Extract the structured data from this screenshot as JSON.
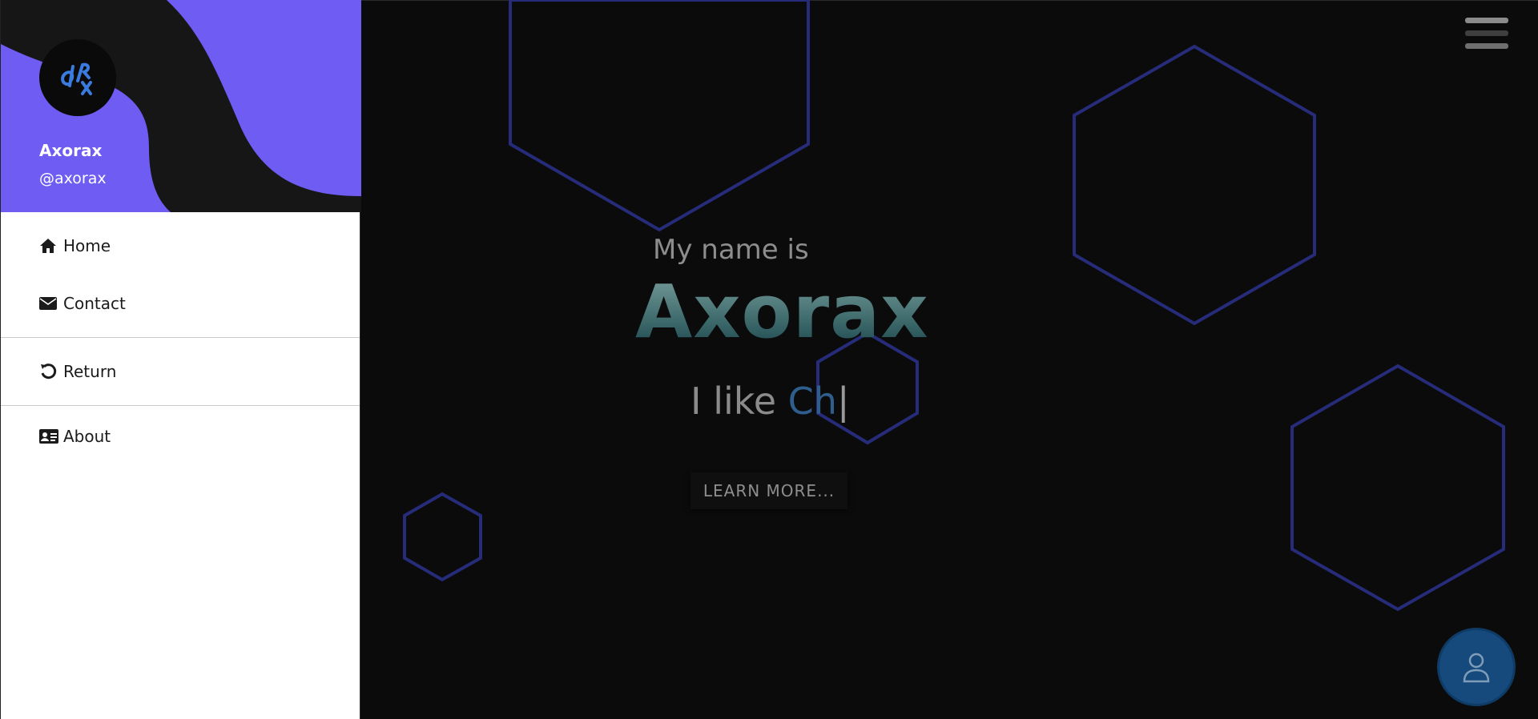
{
  "profile": {
    "name": "Axorax",
    "handle": "@axorax",
    "avatar_icon": "drx-logo-icon"
  },
  "sidebar": {
    "items": [
      {
        "label": "Home",
        "icon": "home-icon"
      },
      {
        "label": "Contact",
        "icon": "envelope-icon"
      },
      {
        "label": "Return",
        "icon": "undo-icon"
      },
      {
        "label": "About",
        "icon": "id-card-icon"
      }
    ]
  },
  "hero": {
    "intro": "My name is",
    "name": "Axorax",
    "typed_prefix": "I like ",
    "typed_word": "Ch",
    "cursor": "|",
    "button_label": "LEARN MORE..."
  },
  "colors": {
    "accent_purple": "#6f5cf2",
    "hex_stroke": "#262c7a",
    "fab_blue": "#164a7d"
  },
  "icons": {
    "menu": "hamburger-menu-icon",
    "fab": "user-icon"
  }
}
